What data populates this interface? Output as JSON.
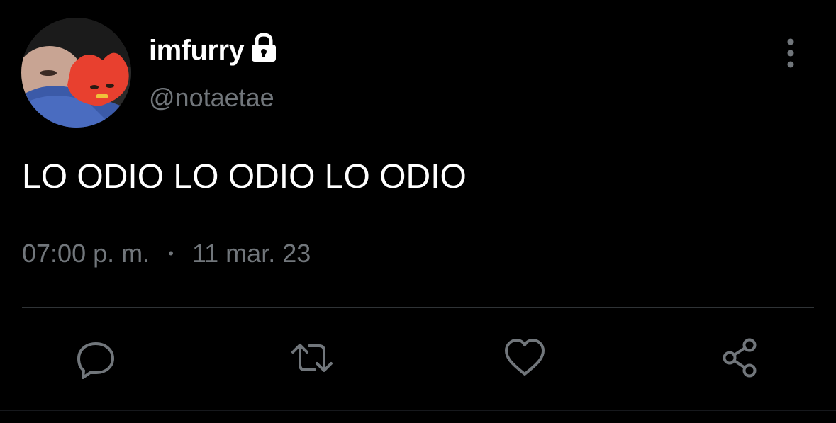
{
  "user": {
    "display_name": "imfurry",
    "handle": "@notaetae",
    "avatar_icon": "profile-photo",
    "protected_icon": "lock-icon"
  },
  "tweet": {
    "text": "LO ODIO LO ODIO LO ODIO",
    "time": "07:00 p. m.",
    "separator": "•",
    "date": "11 mar. 23"
  },
  "actions": [
    {
      "icon": "reply-icon"
    },
    {
      "icon": "retweet-icon"
    },
    {
      "icon": "like-icon"
    },
    {
      "icon": "share-icon"
    }
  ],
  "menu": {
    "icon": "more-options-icon"
  },
  "colors": {
    "background": "#000000",
    "primary_text": "#ffffff",
    "secondary_text": "#71767b",
    "divider": "#2f3336"
  }
}
